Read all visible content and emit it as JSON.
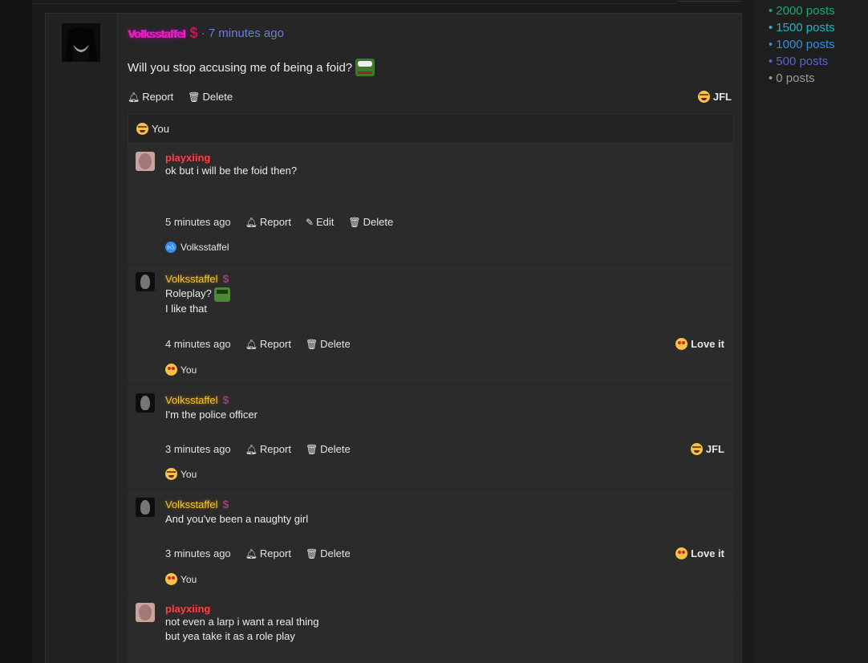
{
  "post": {
    "username": "Volksstaffel",
    "badge_icon": "dollar-icon",
    "time": "· 7 minutes ago",
    "body": "Will you stop accusing me of being a foid?",
    "actions": {
      "report": "Report",
      "delete": "Delete"
    },
    "reaction": "JFL",
    "reaction_line": "You"
  },
  "replies": [
    {
      "username": "playxiing",
      "text": [
        "ok but i will be the foid then?"
      ],
      "time": "5 minutes ago",
      "actions": [
        "Report",
        "Edit",
        "Delete"
      ],
      "reactors": "Volksstaffel"
    },
    {
      "username": "Volksstaffel",
      "text": [
        "Roleplay?",
        "I like that"
      ],
      "time": "4 minutes ago",
      "actions": [
        "Report",
        "Delete"
      ],
      "reaction": "Love it",
      "reactors": "You"
    },
    {
      "username": "Volksstaffel",
      "text": [
        "I'm the police officer"
      ],
      "time": "3 minutes ago",
      "actions": [
        "Report",
        "Delete"
      ],
      "reaction": "JFL",
      "reactors": "You"
    },
    {
      "username": "Volksstaffel",
      "text": [
        "And you've been a naughty girl"
      ],
      "time": "3 minutes ago",
      "actions": [
        "Report",
        "Delete"
      ],
      "reaction": "Love it",
      "reactors": "You"
    },
    {
      "username": "playxiing",
      "text": [
        "not even a larp i want a real thing",
        "but yea take it as a role play"
      ]
    }
  ],
  "rank_list": [
    {
      "label": "2000 posts",
      "color": "#1aa87a"
    },
    {
      "label": "1500 posts",
      "color": "#1cb6c8"
    },
    {
      "label": "1000 posts",
      "color": "#2d8fe6"
    },
    {
      "label": "500 posts",
      "color": "#5a63c9"
    },
    {
      "label": "0 posts",
      "color": "#9a9a9a"
    }
  ]
}
